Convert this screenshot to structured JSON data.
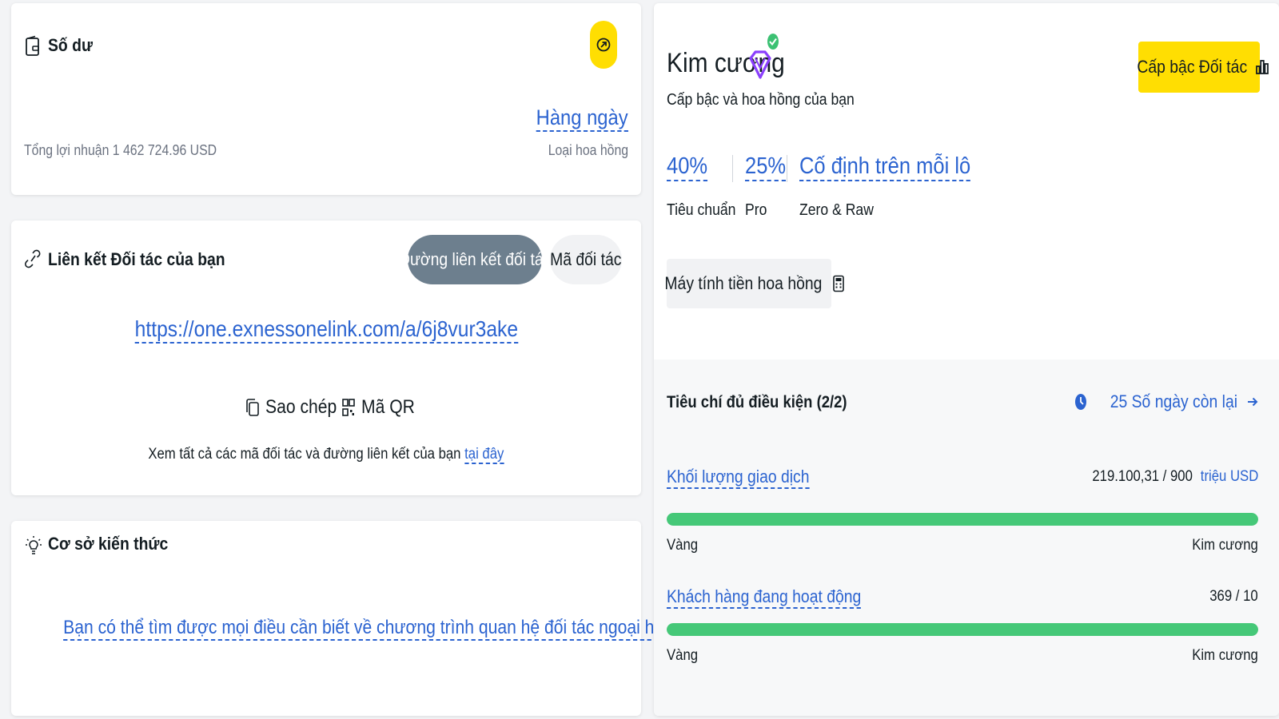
{
  "balance": {
    "title": "Số dư",
    "total_profit": "Tổng lợi nhuận 1 462 724.96 USD",
    "commission_frequency": "Hàng ngày",
    "commission_type_label": "Loại hoa hồng"
  },
  "partner_link": {
    "title": "Liên kết Đối tác của bạn",
    "tab_link": "Đường liên kết đối tác",
    "tab_code": "Mã đối tác",
    "url": "https://one.exnessonelink.com/a/6j8vur3ake",
    "copy_label": "Sao chép",
    "qr_label": "Mã QR",
    "see_all_text": "Xem tất cả các mã đối tác và đường liên kết của bạn",
    "see_all_link": "tại đây"
  },
  "knowledge": {
    "title": "Cơ sở kiến thức",
    "link_text": "Bạn có thể tìm được mọi điều cần biết về chương trình quan hệ đối tác ngoại hối của chúng tôi tại đây"
  },
  "tier": {
    "name": "Kim cương",
    "subtitle": "Cấp bậc và hoa hồng của bạn",
    "tier_button": "Cấp bậc Đối tác",
    "rates": [
      {
        "value": "40%",
        "label": "Tiêu chuẩn"
      },
      {
        "value": "25%",
        "label": "Pro"
      },
      {
        "value": "Cố định trên mỗi lô",
        "label": "Zero & Raw"
      }
    ],
    "calculator_button": "Máy tính tiền hoa hồng"
  },
  "criteria": {
    "title": "Tiêu chí đủ điều kiện (2/2)",
    "days_left": "25 Số ngày còn lại",
    "items": [
      {
        "name": "Khối lượng giao dịch",
        "value": "219.100,31 / 900",
        "unit": "triệu USD",
        "from": "Vàng",
        "to": "Kim cương",
        "progress": 1.0
      },
      {
        "name": "Khách hàng đang hoạt động",
        "value": "369 / 10",
        "from": "Vàng",
        "to": "Kim cương",
        "progress": 1.0
      }
    ]
  },
  "colors": {
    "accent_yellow": "#ffde02",
    "link_blue": "#2b63d0",
    "progress_green": "#45c878",
    "tab_active": "#6d7f8e",
    "diamond_purple": "#8a3ffc",
    "check_green": "#3cc173"
  }
}
